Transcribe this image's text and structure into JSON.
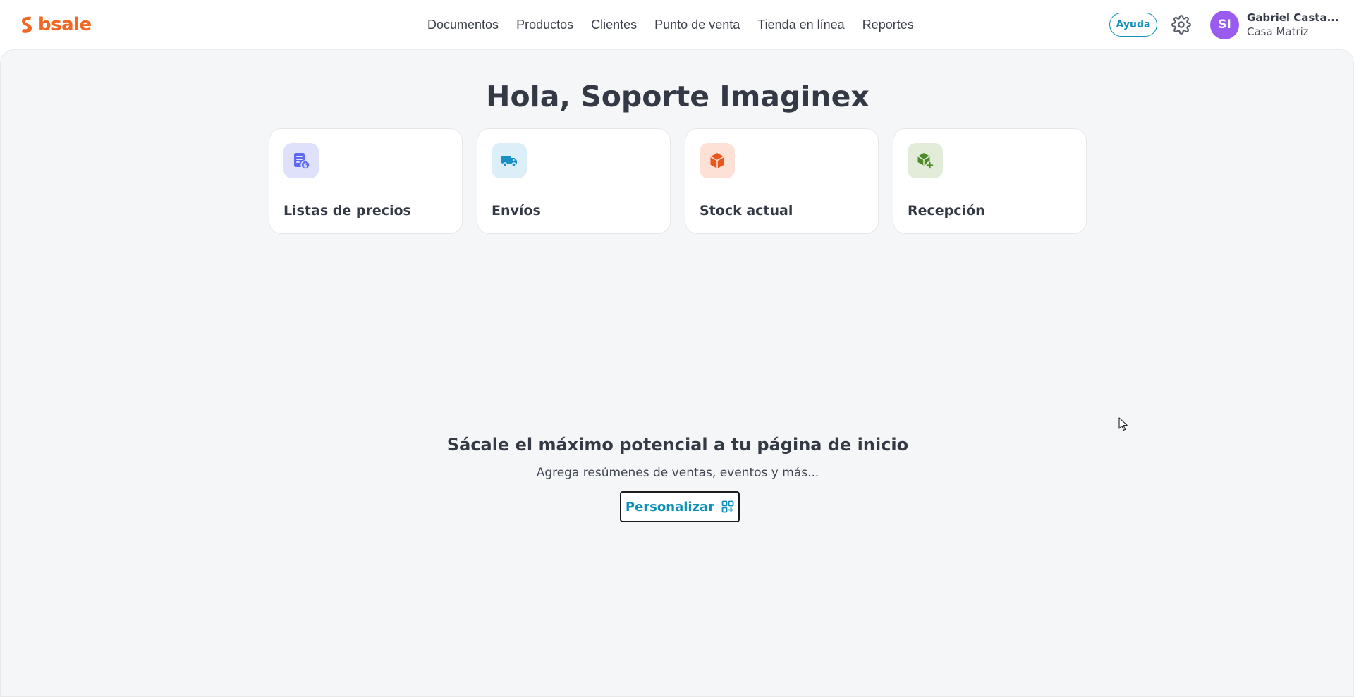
{
  "brand": {
    "name": "bsale",
    "color": "#f26722"
  },
  "nav": {
    "items": [
      {
        "label": "Documentos"
      },
      {
        "label": "Productos"
      },
      {
        "label": "Clientes"
      },
      {
        "label": "Punto de venta"
      },
      {
        "label": "Tienda en línea"
      },
      {
        "label": "Reportes"
      }
    ]
  },
  "header": {
    "help_label": "Ayuda",
    "settings_icon": "gear-icon",
    "user": {
      "initials": "SI",
      "name": "Gabriel Casta...",
      "branch": "Casa Matriz",
      "avatar_color": "#9a5cf0"
    }
  },
  "home": {
    "greeting": "Hola, Soporte Imaginex",
    "shortcuts": [
      {
        "label": "Listas de precios",
        "icon": "price-list-icon",
        "icon_bg": "#dfe1fb",
        "icon_color": "#5d6af0"
      },
      {
        "label": "Envíos",
        "icon": "truck-icon",
        "icon_bg": "#dceff8",
        "icon_color": "#1a8fc4"
      },
      {
        "label": "Stock actual",
        "icon": "box-icon",
        "icon_bg": "#fde0d6",
        "icon_color": "#e8571c"
      },
      {
        "label": "Recepción",
        "icon": "box-add-icon",
        "icon_bg": "#e2ecd9",
        "icon_color": "#4f8a2b"
      }
    ],
    "promo": {
      "title": "Sácale el máximo potencial a tu página de inicio",
      "subtitle": "Agrega resúmenes de ventas, eventos y más...",
      "button_label": "Personalizar",
      "button_icon": "widgets-add-icon"
    }
  },
  "colors": {
    "accent": "#0e8fb8",
    "background": "#f5f6f8",
    "text": "#333a45"
  }
}
